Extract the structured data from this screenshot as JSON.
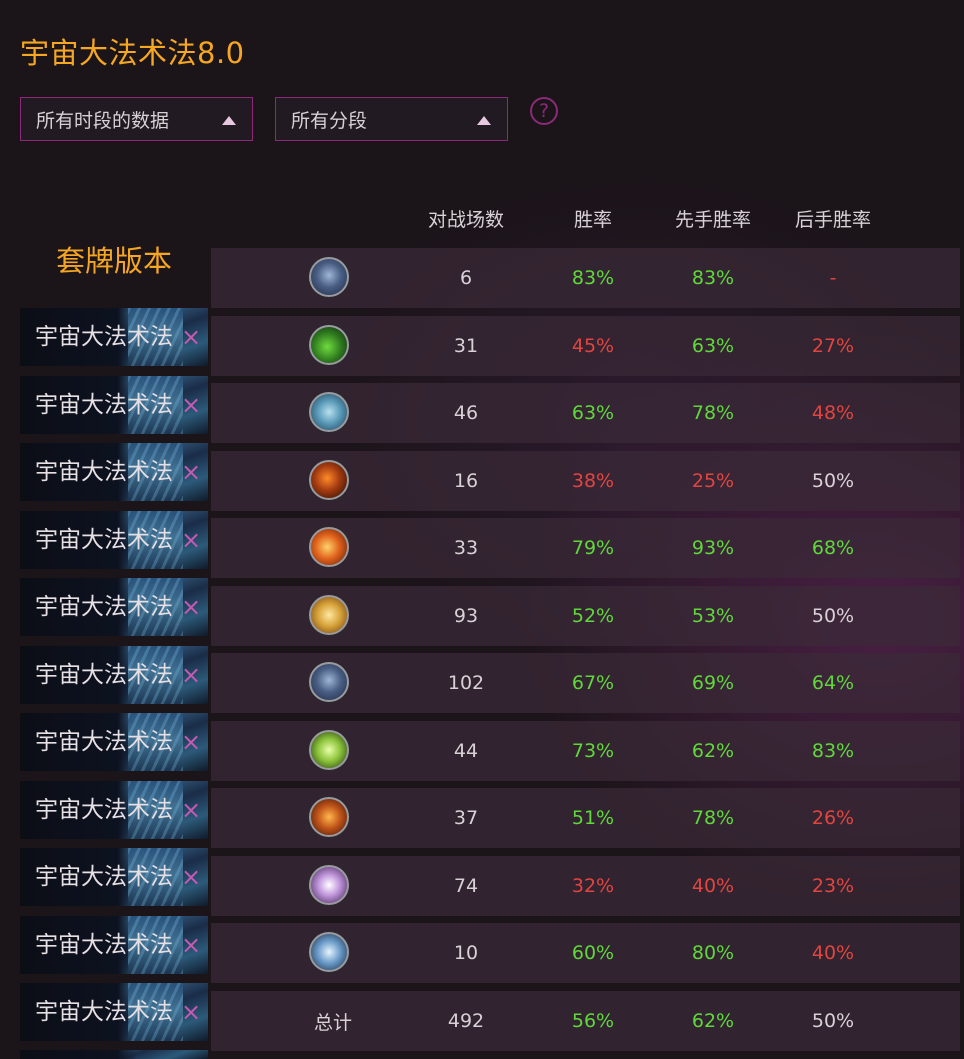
{
  "title": "宇宙大法术法8.0",
  "filters": {
    "time_range": "所有时段的数据",
    "rank": "所有分段",
    "help": "?"
  },
  "columns": {
    "games": "对战场数",
    "winrate": "胜率",
    "first_winrate": "先手胜率",
    "second_winrate": "后手胜率"
  },
  "deck_panel": {
    "header": "套牌版本",
    "remove_glyph": "×",
    "decks": [
      "宇宙大法术法",
      "宇宙大法术法",
      "宇宙大法术法",
      "宇宙大法术法",
      "宇宙大法术法",
      "宇宙大法术法",
      "宇宙大法术法",
      "宇宙大法术法",
      "宇宙大法术法",
      "宇宙大法术法",
      "宇宙大法术法"
    ]
  },
  "rows": [
    {
      "icon": "mage-class-icon",
      "games": "6",
      "winrate": "83%",
      "first": "83%",
      "second": "-"
    },
    {
      "icon": "druid-class-icon",
      "games": "31",
      "winrate": "45%",
      "first": "63%",
      "second": "27%"
    },
    {
      "icon": "shaman-class-icon",
      "games": "46",
      "winrate": "63%",
      "first": "78%",
      "second": "48%"
    },
    {
      "icon": "rogue-class-icon",
      "games": "16",
      "winrate": "38%",
      "first": "25%",
      "second": "50%"
    },
    {
      "icon": "warlock-class-icon",
      "games": "33",
      "winrate": "79%",
      "first": "93%",
      "second": "68%"
    },
    {
      "icon": "paladin-class-icon",
      "games": "93",
      "winrate": "52%",
      "first": "53%",
      "second": "50%"
    },
    {
      "icon": "mage-class-icon",
      "games": "102",
      "winrate": "67%",
      "first": "69%",
      "second": "64%"
    },
    {
      "icon": "hunter-class-icon",
      "games": "44",
      "winrate": "73%",
      "first": "62%",
      "second": "83%"
    },
    {
      "icon": "warrior-class-icon",
      "games": "37",
      "winrate": "51%",
      "first": "78%",
      "second": "26%"
    },
    {
      "icon": "priest-class-icon",
      "games": "74",
      "winrate": "32%",
      "first": "40%",
      "second": "23%"
    },
    {
      "icon": "paladin-sword-class-icon",
      "games": "10",
      "winrate": "60%",
      "first": "80%",
      "second": "40%"
    }
  ],
  "total": {
    "label": "总计",
    "games": "492",
    "winrate": "56%",
    "first": "62%",
    "second": "50%"
  },
  "colors": {
    "accent": "#f5a623",
    "win": "#5fd93a",
    "loss": "#e2453f",
    "border": "#8a2a78"
  }
}
